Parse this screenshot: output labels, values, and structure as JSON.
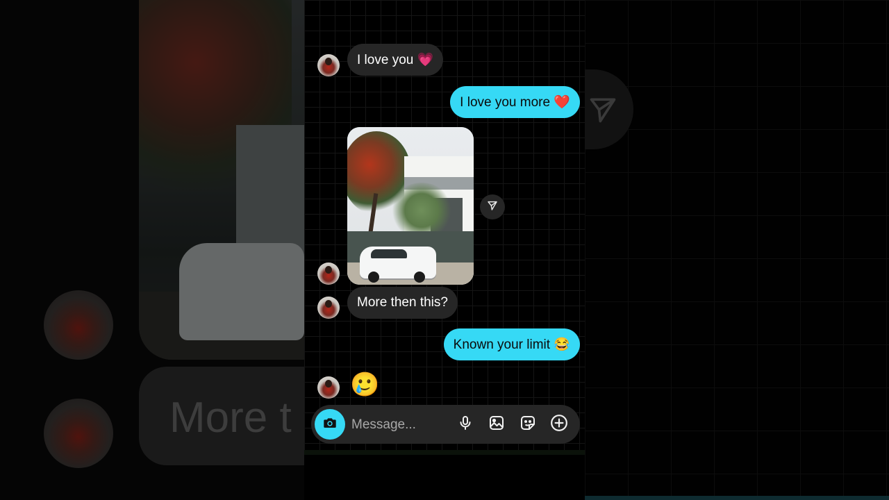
{
  "messages": [
    {
      "id": "m1",
      "direction": "incoming",
      "type": "text",
      "text": "I love you 💗"
    },
    {
      "id": "m2",
      "direction": "outgoing",
      "type": "text",
      "text": "I love you more ❤️"
    },
    {
      "id": "m3",
      "direction": "incoming",
      "type": "photo",
      "description_icon": "photo-thumbnail"
    },
    {
      "id": "m4",
      "direction": "incoming",
      "type": "text",
      "text": "More then this?"
    },
    {
      "id": "m5",
      "direction": "outgoing",
      "type": "text",
      "text": "Known your limit 😂"
    },
    {
      "id": "m6",
      "direction": "incoming",
      "type": "emoji",
      "text": "🥲"
    }
  ],
  "composer": {
    "placeholder": "Message...",
    "icons": [
      "camera-icon",
      "microphone-icon",
      "gallery-icon",
      "sticker-icon",
      "plus-icon"
    ]
  },
  "background": {
    "echo_text": "More t"
  },
  "colors": {
    "outgoing_bubble": "#36d9f5",
    "incoming_bubble": "#262626",
    "background": "#000000"
  }
}
